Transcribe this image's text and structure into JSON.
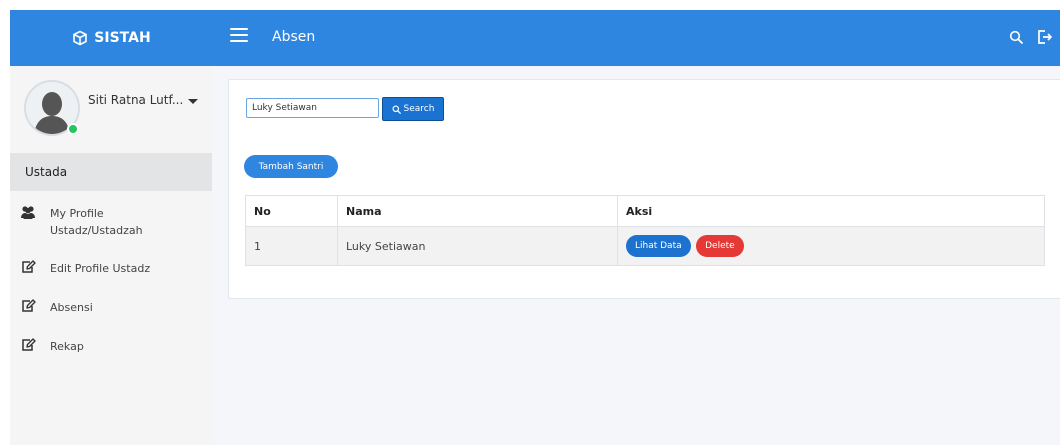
{
  "header": {
    "brand": "SISTAH",
    "page_title": "Absen",
    "bar_color": "#2f86e0",
    "icons": [
      "cube-icon",
      "hamburger-icon",
      "search-icon",
      "logout-icon"
    ]
  },
  "sidebar": {
    "user_name": "Siti Ratna Lutf...",
    "role": "Ustada",
    "items": [
      {
        "label": "My Profile Ustadz/Ustadzah",
        "icon": "users-icon"
      },
      {
        "label": "Edit Profile Ustadz",
        "icon": "edit-icon"
      },
      {
        "label": "Absensi",
        "icon": "edit-icon"
      },
      {
        "label": "Rekap",
        "icon": "edit-icon"
      }
    ]
  },
  "main": {
    "search": {
      "value": "Luky Setiawan",
      "button_label": "Search"
    },
    "add_button_label": "Tambah Santri",
    "table": {
      "columns": [
        "No",
        "Nama",
        "Aksi"
      ],
      "rows": [
        {
          "no": "1",
          "nama": "Luky Setiawan",
          "view_label": "Lihat Data",
          "delete_label": "Delete"
        }
      ]
    }
  },
  "colors": {
    "primary": "#2f86e0",
    "danger": "#e53935",
    "online": "#22c55e"
  }
}
